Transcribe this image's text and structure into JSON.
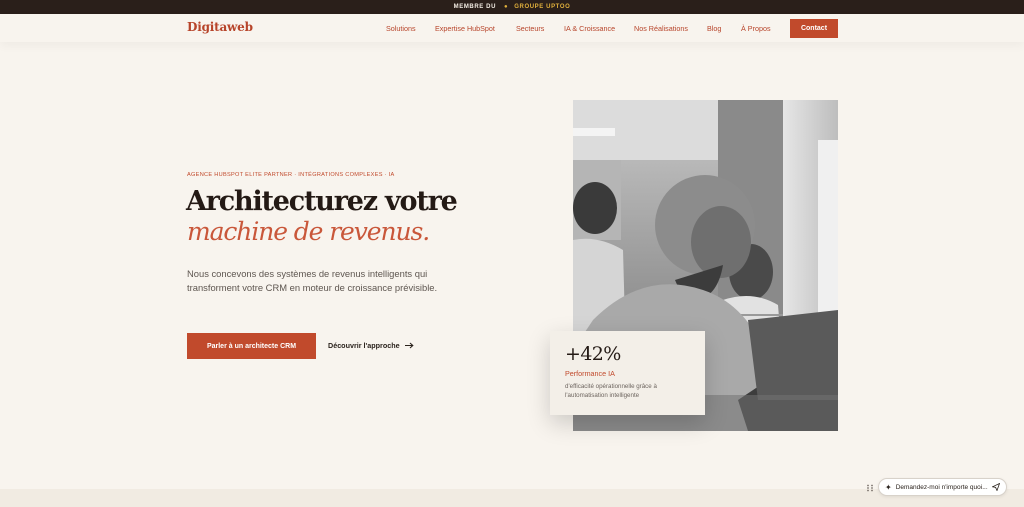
{
  "topbar": {
    "member_label": "MEMBRE DU",
    "brand_label": "GROUPE UPTOO"
  },
  "nav": {
    "logo": "Digitaweb",
    "items": [
      {
        "label": "Solutions"
      },
      {
        "label": "Expertise HubSpot"
      },
      {
        "label": "Secteurs"
      },
      {
        "label": "IA & Croissance"
      },
      {
        "label": "Nos Réalisations"
      },
      {
        "label": "Blog"
      },
      {
        "label": "À Propos"
      }
    ],
    "contact_label": "Contact"
  },
  "hero": {
    "eyebrow": "AGENCE HUBSPOT ELITE PARTNER · INTÉGRATIONS COMPLEXES · IA",
    "title_line1": "Architecturez votre",
    "title_line2": "machine de revenus.",
    "description": "Nous concevons des systèmes de revenus intelligents qui transforment votre CRM en moteur de croissance prévisible.",
    "cta_primary": "Parler à un architecte CRM",
    "cta_secondary": "Découvrir l'approche"
  },
  "stat_card": {
    "value": "+42%",
    "label": "Performance IA",
    "description": "d'efficacité opérationnelle grâce à l'automatisation intelligente"
  },
  "assistant": {
    "placeholder": "Demandez-moi n'importe quoi..."
  },
  "colors": {
    "accent": "#c14a2c",
    "topbar_bg": "#2a1f1a",
    "page_bg": "#f8f4ee",
    "brand_gold": "#e2b13c"
  },
  "icons": [
    "arrow-right-icon",
    "sparkle-icon",
    "send-icon",
    "drag-handle-icon"
  ]
}
